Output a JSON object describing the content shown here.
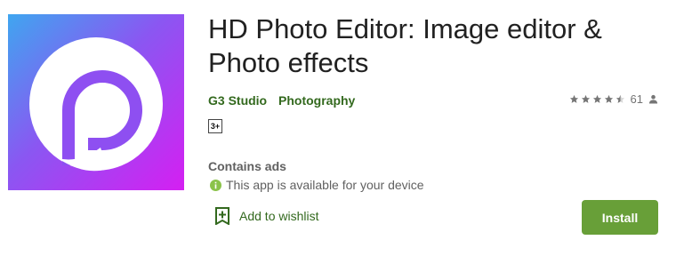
{
  "app": {
    "title": "HD Photo Editor: Image editor & Photo effects",
    "developer": "G3 Studio",
    "category": "Photography",
    "content_rating": "3+",
    "rating": {
      "stars": 4.5,
      "max_stars": 5,
      "count": "61",
      "icon": "person-icon"
    },
    "contains_ads": "Contains ads",
    "availability": "This app is available for your device",
    "icon": "app-logo-p-icon"
  },
  "actions": {
    "wishlist_label": "Add to wishlist",
    "install_label": "Install"
  },
  "colors": {
    "accent": "#33691e",
    "install_bg": "#689f38",
    "info_icon": "#8bc34a",
    "icon_gradient": [
      "#3fa6f0",
      "#8a57f2",
      "#d51ff2"
    ]
  }
}
